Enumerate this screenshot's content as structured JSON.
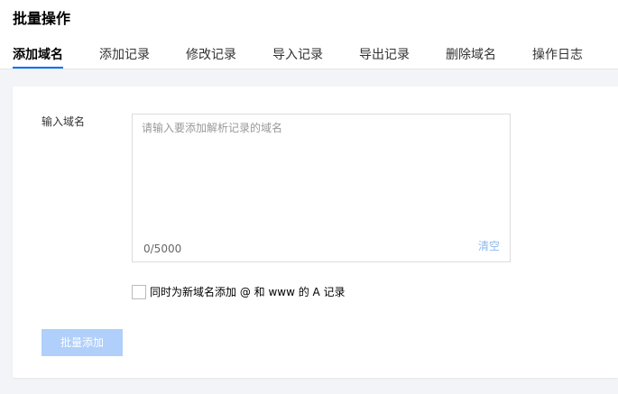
{
  "page": {
    "title": "批量操作"
  },
  "tabs": [
    {
      "label": "添加域名",
      "active": true
    },
    {
      "label": "添加记录",
      "active": false
    },
    {
      "label": "修改记录",
      "active": false
    },
    {
      "label": "导入记录",
      "active": false
    },
    {
      "label": "导出记录",
      "active": false
    },
    {
      "label": "删除域名",
      "active": false
    },
    {
      "label": "操作日志",
      "active": false
    }
  ],
  "form": {
    "domain_label": "输入域名",
    "domain_placeholder": "请输入要添加解析记录的域名",
    "domain_value": "",
    "counter": "0/5000",
    "clear_label": "清空",
    "checkbox_label": "同时为新域名添加 @ 和 www 的 A 记录",
    "checkbox_checked": false,
    "submit_label": "批量添加"
  },
  "colors": {
    "accent": "#006eff",
    "button_disabled": "#b0cffb",
    "clear_link": "#8fb8ef",
    "background": "#f3f4f7"
  }
}
